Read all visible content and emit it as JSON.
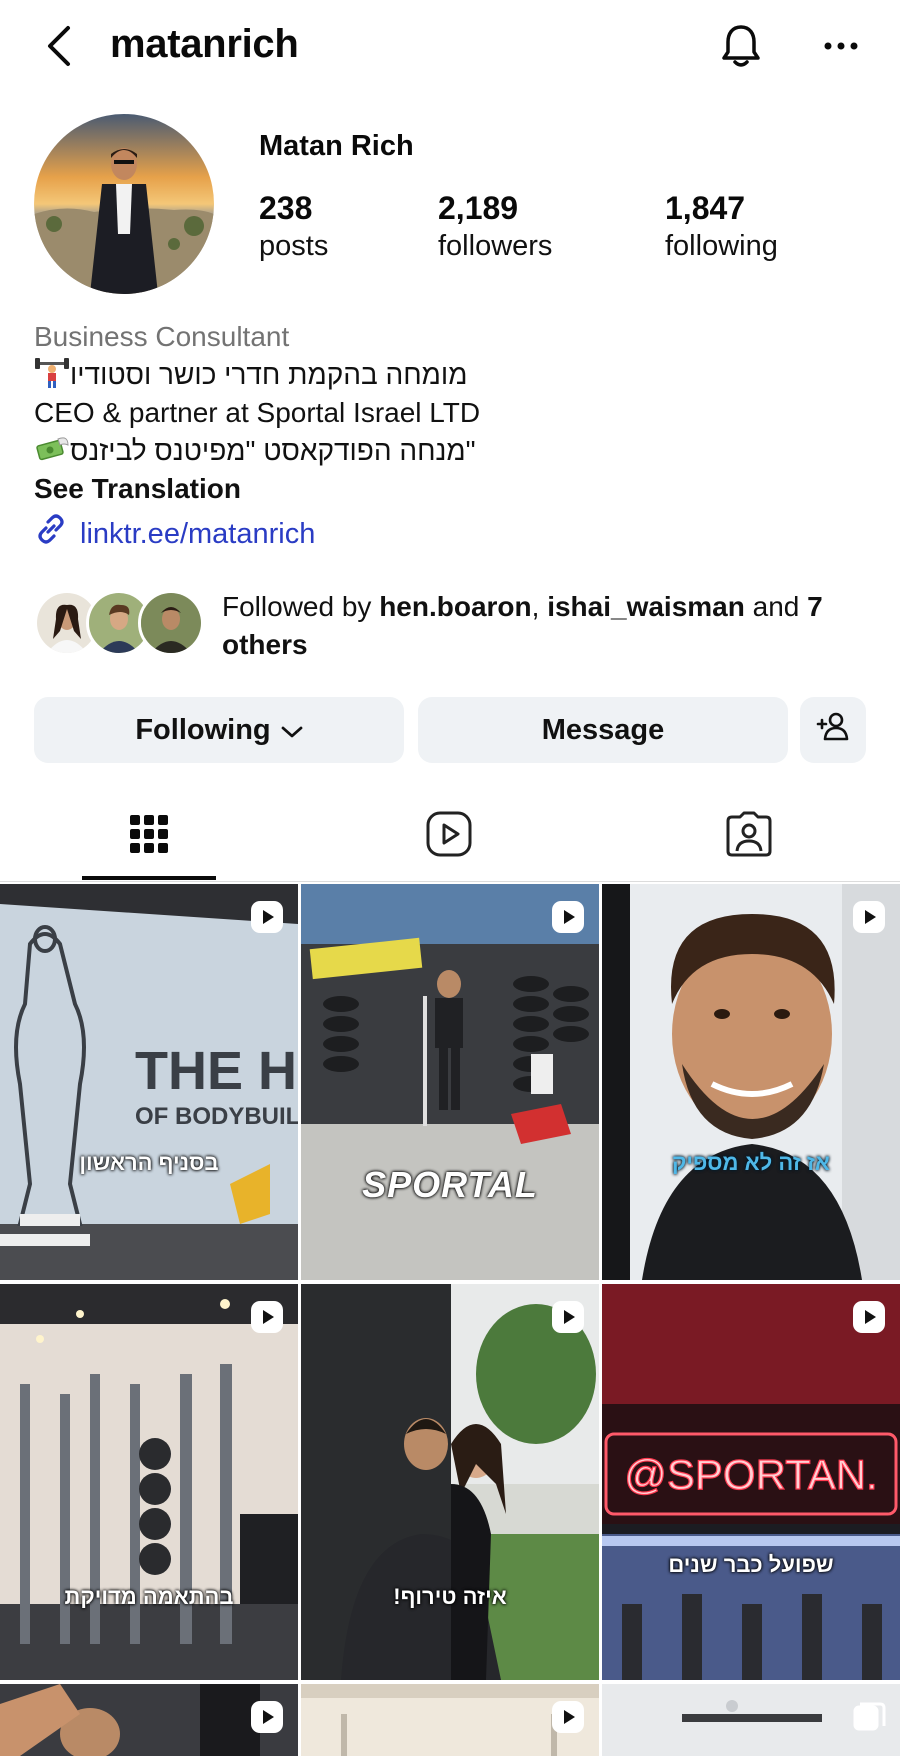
{
  "header": {
    "username": "matanrich"
  },
  "profile": {
    "display_name": "Matan Rich",
    "stats": [
      {
        "value": "238",
        "label": "posts"
      },
      {
        "value": "2,189",
        "label": "followers"
      },
      {
        "value": "1,847",
        "label": "following"
      }
    ],
    "category": "Business Consultant",
    "bio_lines": [
      "מומחה בהקמת חדרי כושר וסטודיו",
      "CEO & partner at Sportal Israel LTD",
      "מנחה הפודקאסט \"מפיטנס לביזנס\""
    ],
    "see_translation": "See Translation",
    "link": "linktr.ee/matanrich"
  },
  "followed_by": {
    "prefix": "Followed by ",
    "names": [
      "hen.boaron",
      "ishai_waisman"
    ],
    "separator": ", ",
    "and": " and ",
    "others": "7 others"
  },
  "actions": {
    "following_label": "Following",
    "message_label": "Message"
  },
  "tabs": [
    "grid-icon",
    "reels-icon",
    "tagged-icon"
  ],
  "grid": [
    {
      "caption": "בסניף הראשון",
      "theme": "home"
    },
    {
      "caption": "SPORTAL",
      "theme": "sportal"
    },
    {
      "caption": "אז זה לא מספיק",
      "theme": "portrait"
    },
    {
      "caption": "בהתאמה מדויקת",
      "theme": "gym"
    },
    {
      "caption": "איזה טירוף!",
      "theme": "hug"
    },
    {
      "caption": "שפועל כבר שנים",
      "theme": "neon"
    }
  ],
  "grid_overlay_text": {
    "home_wall": "THE HOME",
    "home_wall_sub": "OF BODYBUILDING",
    "neon_sign": "@SPORTAN."
  },
  "colors": {
    "link": "#2a3cc4",
    "button_bg": "#eff2f5",
    "muted": "#737373"
  }
}
